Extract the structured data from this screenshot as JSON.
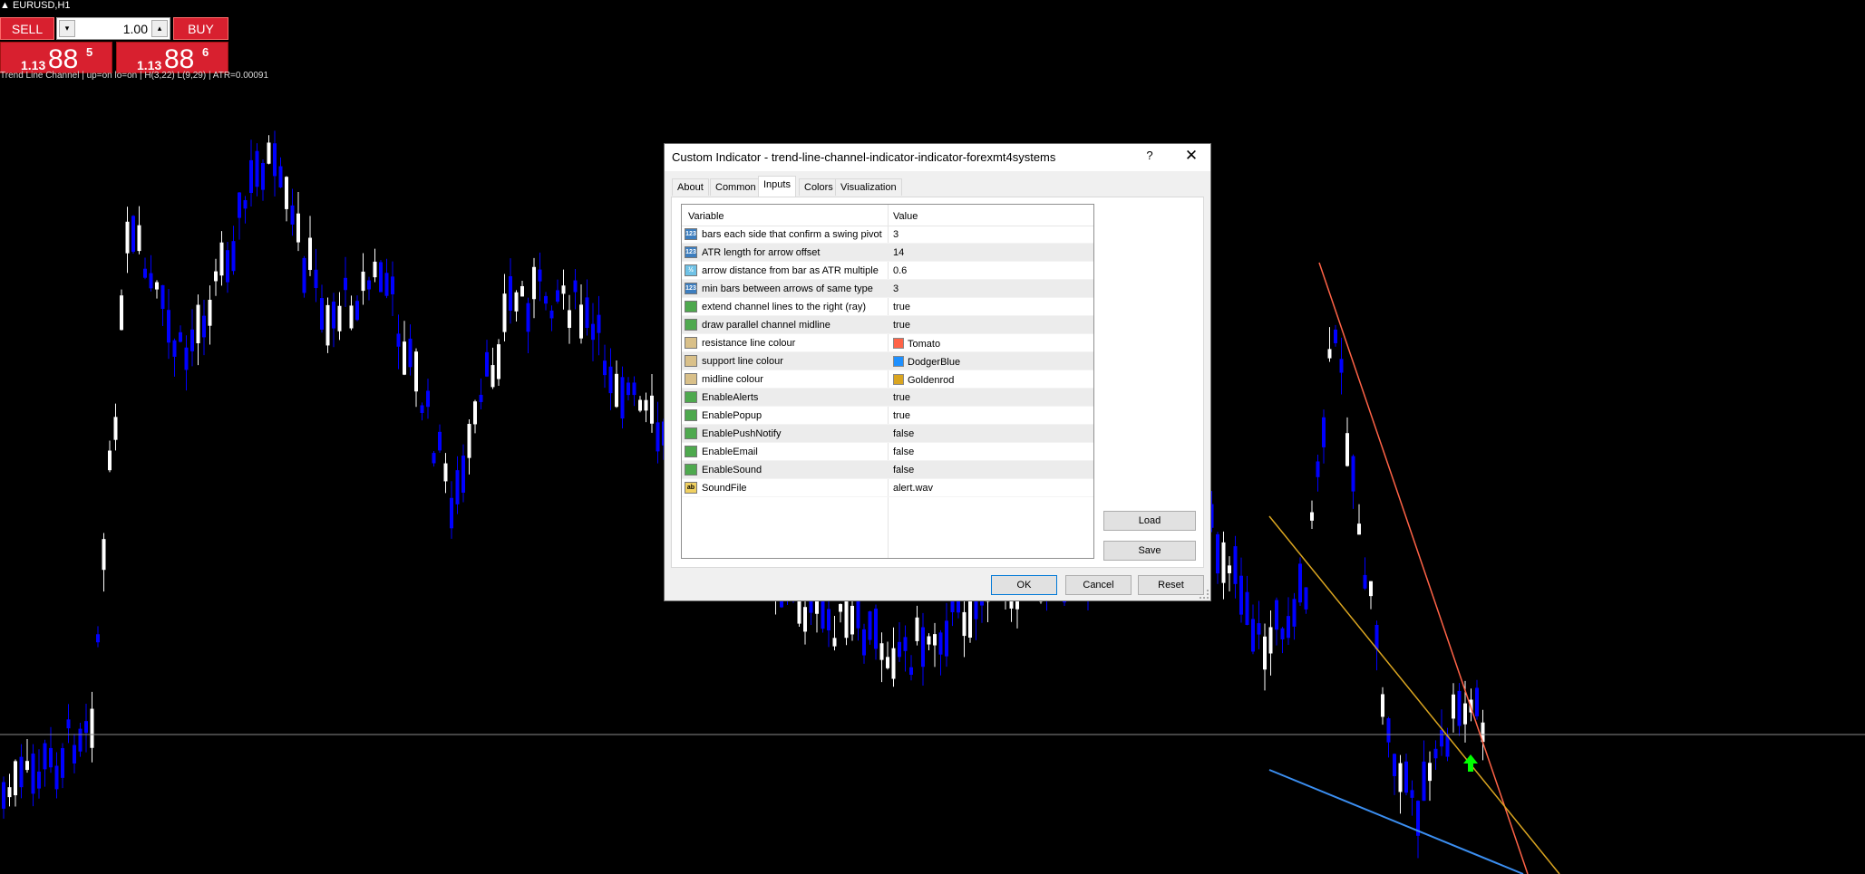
{
  "chart": {
    "symbol": "EURUSD,H1",
    "indicator_label": "Trend Line Channel | up=on lo=on | H(3,22) L(9,29) | ATR=0.00091"
  },
  "trade_panel": {
    "sell_label": "SELL",
    "buy_label": "BUY",
    "lot_value": "1.00",
    "bid_small": "1.13",
    "bid_big": "88",
    "bid_sup": "5",
    "ask_small": "1.13",
    "ask_big": "88",
    "ask_sup": "6"
  },
  "dialog": {
    "title": "Custom Indicator - trend-line-channel-indicator-indicator-forexmt4systems",
    "help_label": "?",
    "close_label": "✕",
    "tabs": [
      {
        "label": "About"
      },
      {
        "label": "Common"
      },
      {
        "label": "Inputs",
        "active": true
      },
      {
        "label": "Colors"
      },
      {
        "label": "Visualization"
      }
    ],
    "grid": {
      "col_variable": "Variable",
      "col_value": "Value",
      "rows": [
        {
          "variable": "bars each side that confirm a swing pivot",
          "value": "3",
          "icon": "int-icon",
          "icon_text": "123"
        },
        {
          "variable": "ATR length for arrow offset",
          "value": "14",
          "icon": "int-icon",
          "icon_text": "123"
        },
        {
          "variable": "arrow distance from bar as ATR multiple",
          "value": "0.6",
          "icon": "double-icon",
          "icon_text": "½"
        },
        {
          "variable": "min bars between arrows of same type",
          "value": "3",
          "icon": "int-icon",
          "icon_text": "123"
        },
        {
          "variable": "extend channel lines to the right (ray)",
          "value": "true",
          "icon": "bool-icon",
          "icon_text": ""
        },
        {
          "variable": "draw parallel channel midline",
          "value": "true",
          "icon": "bool-icon",
          "icon_text": ""
        },
        {
          "variable": "resistance line colour",
          "value": "Tomato",
          "icon": "color-icon",
          "icon_text": "",
          "swatch": "#ff6347"
        },
        {
          "variable": "support line colour",
          "value": "DodgerBlue",
          "icon": "color-icon",
          "icon_text": "",
          "swatch": "#1e90ff"
        },
        {
          "variable": "midline colour",
          "value": "Goldenrod",
          "icon": "color-icon",
          "icon_text": "",
          "swatch": "#daa520"
        },
        {
          "variable": "EnableAlerts",
          "value": "true",
          "icon": "bool-icon",
          "icon_text": ""
        },
        {
          "variable": "EnablePopup",
          "value": "true",
          "icon": "bool-icon",
          "icon_text": ""
        },
        {
          "variable": "EnablePushNotify",
          "value": "false",
          "icon": "bool-icon",
          "icon_text": ""
        },
        {
          "variable": "EnableEmail",
          "value": "false",
          "icon": "bool-icon",
          "icon_text": ""
        },
        {
          "variable": "EnableSound",
          "value": "false",
          "icon": "bool-icon",
          "icon_text": ""
        },
        {
          "variable": "SoundFile",
          "value": "alert.wav",
          "icon": "string-icon",
          "icon_text": "ab"
        }
      ]
    },
    "load_label": "Load",
    "save_label": "Save",
    "ok_label": "OK",
    "cancel_label": "Cancel",
    "reset_label": "Reset"
  },
  "colors": {
    "resistance": "#ff6347",
    "support": "#3b8ef0",
    "midline": "#daa520",
    "bull_candle": "#ffffff",
    "bear_candle": "#0000ff",
    "arrow": "#00ff00"
  }
}
